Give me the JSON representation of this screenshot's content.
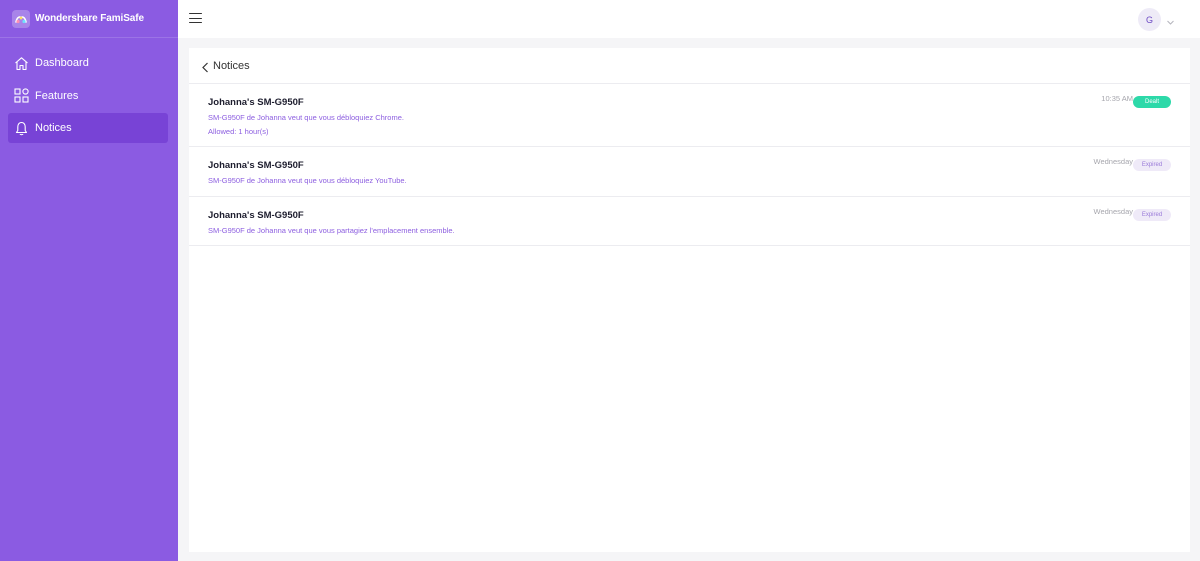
{
  "app": {
    "name": "Wondershare FamiSafe"
  },
  "sidebar": {
    "items": [
      {
        "label": "Dashboard",
        "icon": "home-icon",
        "active": false
      },
      {
        "label": "Features",
        "icon": "grid-icon",
        "active": false
      },
      {
        "label": "Notices",
        "icon": "bell-icon",
        "active": true
      }
    ]
  },
  "topbar": {
    "avatar_initial": "G"
  },
  "page": {
    "title": "Notices"
  },
  "notices": [
    {
      "title": "Johanna's SM-G950F",
      "message": "SM-G950F de Johanna veut que vous débloquiez Chrome.",
      "extra": "Allowed: 1 hour(s)",
      "time": "10:35 AM",
      "status": "Dealt"
    },
    {
      "title": "Johanna's SM-G950F",
      "message": "SM-G950F de Johanna veut que vous débloquiez YouTube.",
      "time": "Wednesday",
      "status": "Expired"
    },
    {
      "title": "Johanna's SM-G950F",
      "message": "SM-G950F de Johanna veut que vous partagiez l'emplacement ensemble.",
      "time": "Wednesday",
      "status": "Expired"
    }
  ],
  "colors": {
    "sidebar": "#8b5be2",
    "sidebar_active": "#7843d6",
    "dealt": "#2dd9a9",
    "accent_text": "#8d5fe0"
  }
}
